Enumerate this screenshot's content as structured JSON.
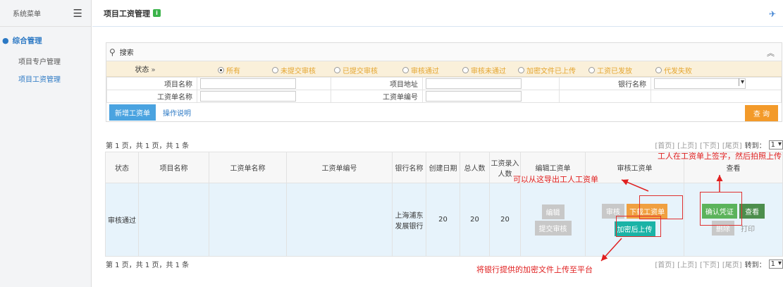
{
  "sidebar": {
    "title": "系统菜单",
    "group": "综合管理",
    "items": [
      {
        "label": "项目专户管理",
        "active": false
      },
      {
        "label": "项目工资管理",
        "active": true
      }
    ]
  },
  "header": {
    "title": "项目工资管理"
  },
  "search": {
    "label": "搜索",
    "status_label": "状态",
    "status_options": [
      "所有",
      "未提交审核",
      "已提交审核",
      "审核通过",
      "审核未通过",
      "加密文件已上传",
      "工资已发放",
      "代发失败"
    ],
    "selected_status": "所有",
    "fields": {
      "project_name": "项目名称",
      "project_address": "项目地址",
      "bank_name": "银行名称",
      "payroll_name": "工资单名称",
      "payroll_no": "工资单编号"
    },
    "new_button": "新增工资单",
    "help_link": "操作说明",
    "query_button": "查 询"
  },
  "pager": {
    "summary": "第 1 页，共 1 页，共 1 条",
    "first": "[首页]",
    "prev": "[上页]",
    "next": "[下页]",
    "last": "[尾页]",
    "goto": "转到：",
    "page": "1"
  },
  "table": {
    "headers": [
      "状态",
      "项目名称",
      "工资单名称",
      "工资单编号",
      "银行名称",
      "创建日期",
      "总人数",
      "工资录入人数",
      "编辑工资单",
      "审核工资单",
      "查看"
    ],
    "row": {
      "status": "审核通过",
      "bank": "上海浦东发展银行",
      "date": "20",
      "total": "20",
      "entered": "20",
      "edit_btn": "编辑",
      "submit_btn": "提交审核",
      "audit_btn": "审核",
      "download_btn": "下载工资单",
      "upload_btn": "加密后上传",
      "confirm_btn": "确认凭证",
      "view_btn": "查看",
      "delete_btn": "删除",
      "print_btn": "打印"
    }
  },
  "annotations": {
    "export": "可以从这导出工人工资单",
    "sign": "工人在工资单上签字，然后拍照上传",
    "upload": "将银行提供的加密文件上传至平台"
  },
  "colors": {
    "accent": "#2b78c4",
    "annotation": "#e02020",
    "query": "#f39a2a"
  }
}
